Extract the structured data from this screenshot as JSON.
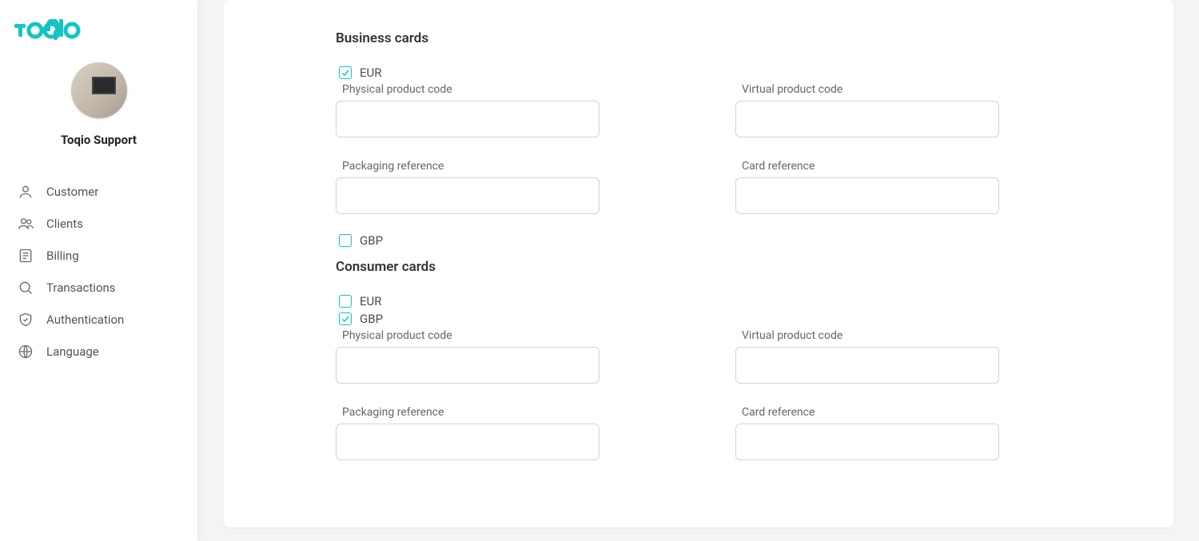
{
  "brand": {
    "name": "toqio",
    "color": "#14c4c4"
  },
  "profile": {
    "name": "Toqio Support"
  },
  "nav": {
    "items": [
      {
        "label": "Customer",
        "icon": "user-icon"
      },
      {
        "label": "Clients",
        "icon": "users-icon"
      },
      {
        "label": "Billing",
        "icon": "billing-icon"
      },
      {
        "label": "Transactions",
        "icon": "search-icon"
      },
      {
        "label": "Authentication",
        "icon": "shield-icon"
      },
      {
        "label": "Language",
        "icon": "globe-icon"
      }
    ]
  },
  "sections": {
    "business": {
      "title": "Business cards",
      "currencies": [
        {
          "code": "EUR",
          "checked": true
        },
        {
          "code": "GBP",
          "checked": false
        }
      ],
      "fields": {
        "physical_product_code": {
          "label": "Physical product code",
          "value": ""
        },
        "virtual_product_code": {
          "label": "Virtual product code",
          "value": ""
        },
        "packaging_reference": {
          "label": "Packaging reference",
          "value": ""
        },
        "card_reference": {
          "label": "Card reference",
          "value": ""
        }
      }
    },
    "consumer": {
      "title": "Consumer cards",
      "currencies": [
        {
          "code": "EUR",
          "checked": false
        },
        {
          "code": "GBP",
          "checked": true
        }
      ],
      "fields": {
        "physical_product_code": {
          "label": "Physical product code",
          "value": ""
        },
        "virtual_product_code": {
          "label": "Virtual product code",
          "value": ""
        },
        "packaging_reference": {
          "label": "Packaging reference",
          "value": ""
        },
        "card_reference": {
          "label": "Card reference",
          "value": ""
        }
      }
    }
  }
}
